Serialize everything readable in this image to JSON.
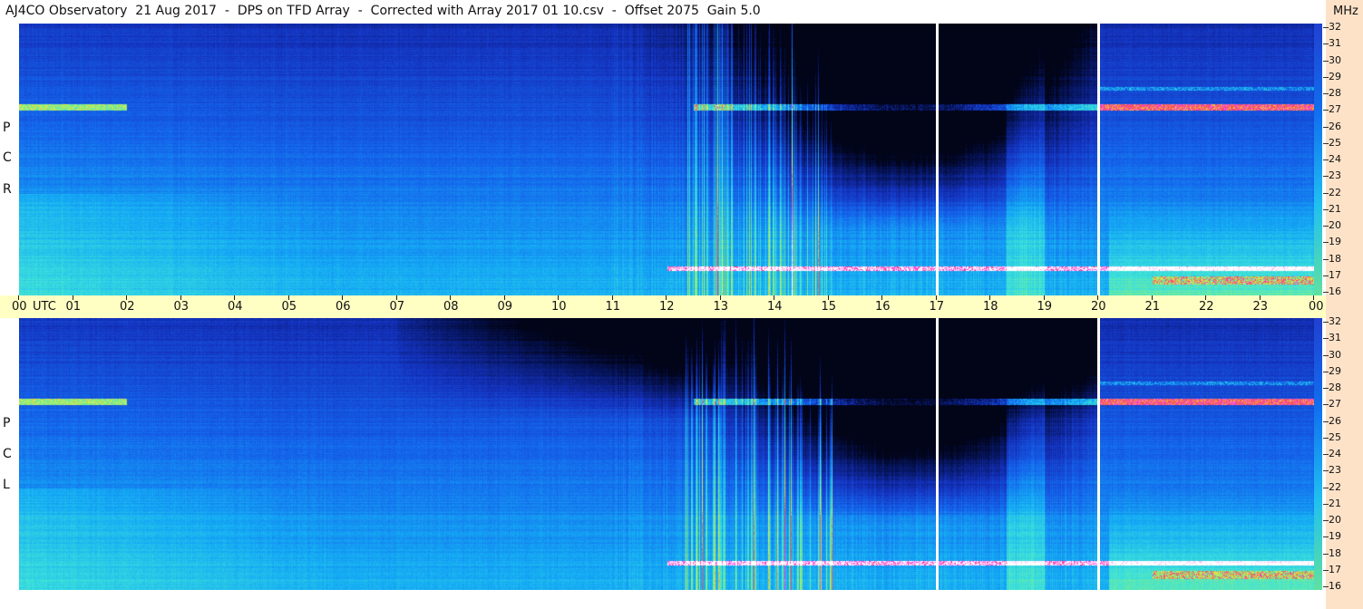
{
  "title": "AJ4CO Observatory  21 Aug 2017  -  DPS on TFD Array  -  Corrected with Array 2017 01 10.csv  -  Offset 2075  Gain 5.0",
  "chart_data": [
    {
      "type": "heatmap",
      "panel": "RCP",
      "polarization_letters": [
        "R",
        "C",
        "P"
      ],
      "x_axis": {
        "labels": [
          "00",
          "01",
          "02",
          "03",
          "04",
          "05",
          "06",
          "07",
          "08",
          "09",
          "10",
          "11",
          "12",
          "13",
          "14",
          "15",
          "16",
          "17",
          "18",
          "19",
          "20",
          "21",
          "22",
          "23",
          "00"
        ],
        "unit": "UTC",
        "range": [
          0,
          24
        ]
      },
      "y_axis": {
        "labels": [
          "32",
          "31",
          "30",
          "29",
          "28",
          "27",
          "26",
          "25",
          "24",
          "23",
          "22",
          "21",
          "20",
          "19",
          "18",
          "17",
          "16"
        ],
        "unit": "MHz",
        "range": [
          16,
          32
        ]
      },
      "data_gaps_utc": [
        17.0,
        20.0
      ]
    },
    {
      "type": "heatmap",
      "panel": "LCP",
      "polarization_letters": [
        "L",
        "C",
        "P"
      ],
      "x_axis": {
        "labels": [
          "00",
          "01",
          "02",
          "03",
          "04",
          "05",
          "06",
          "07",
          "08",
          "09",
          "10",
          "11",
          "12",
          "13",
          "14",
          "15",
          "16",
          "17",
          "18",
          "19",
          "20",
          "21",
          "22",
          "23",
          "00"
        ],
        "unit": "UTC",
        "range": [
          0,
          24
        ]
      },
      "y_axis": {
        "labels": [
          "32",
          "31",
          "30",
          "29",
          "28",
          "27",
          "26",
          "25",
          "24",
          "23",
          "22",
          "21",
          "20",
          "19",
          "18",
          "17",
          "16"
        ],
        "unit": "MHz",
        "range": [
          16,
          32
        ]
      },
      "data_gaps_utc": [
        17.0,
        20.0
      ]
    }
  ],
  "time_axis_unit": "UTC",
  "freq_axis_unit": "MHz",
  "colors": {
    "timebar": "#ffffc4",
    "right_strip": "#fde2c8",
    "background": "#ffffff"
  }
}
